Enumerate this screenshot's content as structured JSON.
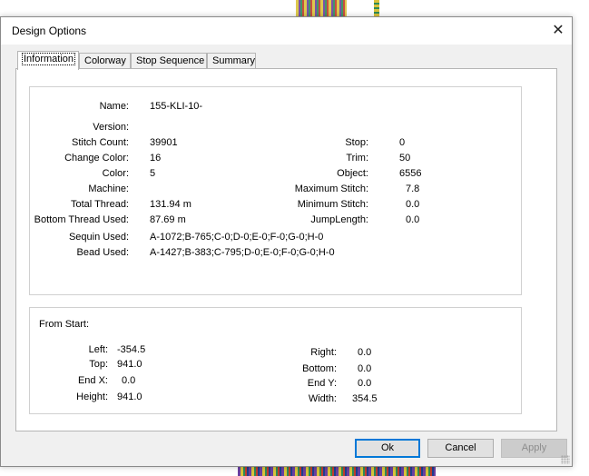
{
  "window": {
    "title": "Design Options",
    "close_glyph": "✕"
  },
  "tabs": [
    {
      "label": "Information",
      "active": true
    },
    {
      "label": "Colorway",
      "active": false
    },
    {
      "label": "Stop Sequence",
      "active": false
    },
    {
      "label": "Summary",
      "active": false
    }
  ],
  "info": {
    "left": [
      {
        "label": "Name:",
        "value": "155-KLI-10-"
      },
      {
        "label": "Version:",
        "value": ""
      },
      {
        "label": "Stitch Count:",
        "value": "39901"
      },
      {
        "label": "Change Color:",
        "value": "16"
      },
      {
        "label": "Color:",
        "value": "5"
      },
      {
        "label": "Machine:",
        "value": ""
      },
      {
        "label": "Total Thread:",
        "value": "131.94 m"
      },
      {
        "label": "Bottom Thread Used:",
        "value": "87.69 m"
      },
      {
        "label": "Sequin Used:",
        "value": "A-1072;B-765;C-0;D-0;E-0;F-0;G-0;H-0"
      },
      {
        "label": "Bead Used:",
        "value": "A-1427;B-383;C-795;D-0;E-0;F-0;G-0;H-0"
      }
    ],
    "right": [
      {
        "label": "Stop:",
        "value": "0"
      },
      {
        "label": "Trim:",
        "value": "50"
      },
      {
        "label": "Object:",
        "value": "6556"
      },
      {
        "label": "Maximum Stitch:",
        "value": "7.8"
      },
      {
        "label": "Minimum Stitch:",
        "value": "0.0"
      },
      {
        "label": "JumpLength:",
        "value": "0.0"
      }
    ]
  },
  "from_start": {
    "heading": "From Start:",
    "left": [
      {
        "label": "Left:",
        "value": "-354.5"
      },
      {
        "label": "Top:",
        "value": "941.0"
      },
      {
        "label": "End X:",
        "value": "0.0"
      },
      {
        "label": "Height:",
        "value": "941.0"
      }
    ],
    "right": [
      {
        "label": "Right:",
        "value": "0.0"
      },
      {
        "label": "Bottom:",
        "value": "0.0"
      },
      {
        "label": "End Y:",
        "value": "0.0"
      },
      {
        "label": "Width:",
        "value": "354.5"
      }
    ]
  },
  "buttons": {
    "ok": "Ok",
    "cancel": "Cancel",
    "apply": "Apply"
  },
  "colors": {
    "default_button_border": "#0078d7",
    "dialog_bg": "#f0f0f0"
  }
}
